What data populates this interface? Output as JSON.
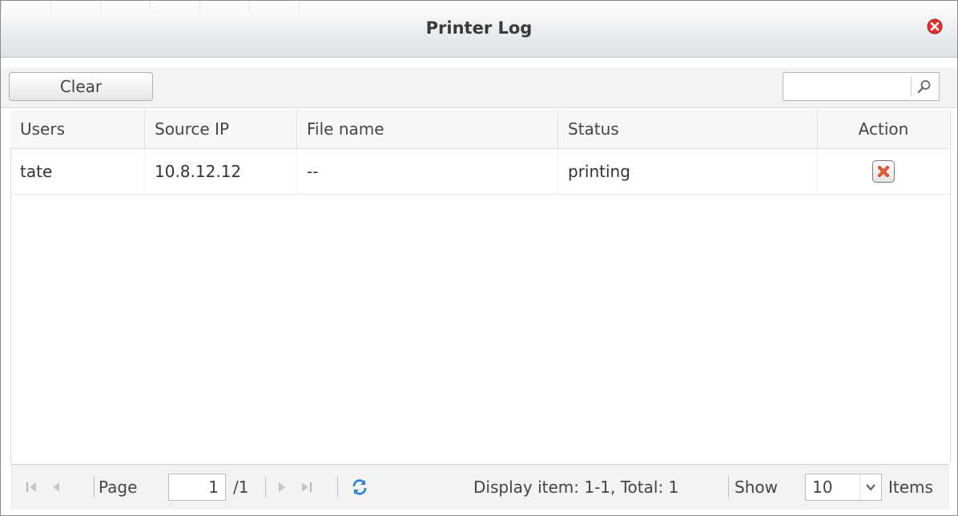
{
  "window": {
    "title": "Printer Log"
  },
  "toolbar": {
    "clear_label": "Clear",
    "search_value": "",
    "search_placeholder": ""
  },
  "table": {
    "columns": [
      "Users",
      "Source IP",
      "File name",
      "Status",
      "Action"
    ],
    "rows": [
      {
        "user": "tate",
        "source_ip": "10.8.12.12",
        "file_name": "--",
        "status": "printing"
      }
    ]
  },
  "pager": {
    "page_label": "Page",
    "page_value": "1",
    "page_total": "/1",
    "display_text": "Display item: 1-1, Total: 1",
    "show_label": "Show",
    "show_value": "10",
    "items_label": "Items"
  },
  "colors": {
    "close": "#e0322d",
    "refresh": "#2d7fd3",
    "delete": "#d9361e"
  }
}
